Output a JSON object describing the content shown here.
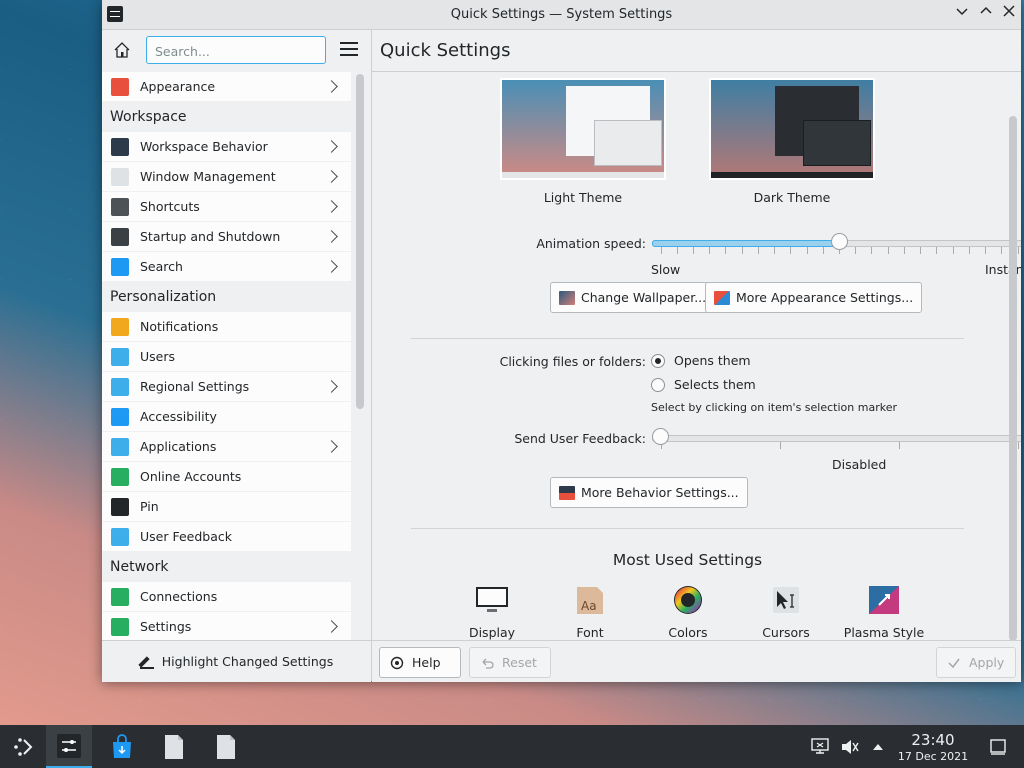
{
  "window": {
    "title": "Quick Settings — System Settings"
  },
  "search": {
    "placeholder": "Search..."
  },
  "sidebar": {
    "items": [
      {
        "label": "Appearance",
        "type": "item",
        "chevron": true,
        "icon": "appearance-icon",
        "color": "#e84f3d"
      },
      {
        "label": "Workspace",
        "type": "section"
      },
      {
        "label": "Workspace Behavior",
        "type": "item",
        "chevron": true,
        "icon": "workspace-behavior-icon",
        "color": "#2d3a4a"
      },
      {
        "label": "Window Management",
        "type": "item",
        "chevron": true,
        "icon": "window-management-icon",
        "color": "#dfe2e5"
      },
      {
        "label": "Shortcuts",
        "type": "item",
        "chevron": true,
        "icon": "keyboard-icon",
        "color": "#4d5257"
      },
      {
        "label": "Startup and Shutdown",
        "type": "item",
        "chevron": true,
        "icon": "monitor-icon",
        "color": "#3b4045"
      },
      {
        "label": "Search",
        "type": "item",
        "chevron": true,
        "icon": "search-icon",
        "color": "#1d99f3"
      },
      {
        "label": "Personalization",
        "type": "section"
      },
      {
        "label": "Notifications",
        "type": "item",
        "chevron": false,
        "icon": "bell-icon",
        "color": "#f2a81d"
      },
      {
        "label": "Users",
        "type": "item",
        "chevron": false,
        "icon": "users-icon",
        "color": "#3daee9"
      },
      {
        "label": "Regional Settings",
        "type": "item",
        "chevron": true,
        "icon": "regional-icon",
        "color": "#3daee9"
      },
      {
        "label": "Accessibility",
        "type": "item",
        "chevron": false,
        "icon": "accessibility-icon",
        "color": "#1d99f3"
      },
      {
        "label": "Applications",
        "type": "item",
        "chevron": true,
        "icon": "applications-icon",
        "color": "#3daee9"
      },
      {
        "label": "Online Accounts",
        "type": "item",
        "chevron": false,
        "icon": "globe-icon",
        "color": "#27ae60"
      },
      {
        "label": "Pin",
        "type": "item",
        "chevron": false,
        "icon": "lock-icon",
        "color": "#232629"
      },
      {
        "label": "User Feedback",
        "type": "item",
        "chevron": false,
        "icon": "feedback-icon",
        "color": "#3daee9"
      },
      {
        "label": "Network",
        "type": "section"
      },
      {
        "label": "Connections",
        "type": "item",
        "chevron": false,
        "icon": "globe-icon",
        "color": "#27ae60"
      },
      {
        "label": "Settings",
        "type": "item",
        "chevron": true,
        "icon": "globe-icon",
        "color": "#27ae60"
      }
    ],
    "highlight_label": "Highlight Changed Settings"
  },
  "main": {
    "title": "Quick Settings",
    "themes": [
      {
        "label": "Light Theme"
      },
      {
        "label": "Dark Theme"
      }
    ],
    "animation": {
      "label": "Animation speed:",
      "min_label": "Slow",
      "max_label": "Instant",
      "value": 0.5
    },
    "buttons": {
      "change_wallpaper": "Change Wallpaper...",
      "more_appearance": "More Appearance Settings...",
      "more_behavior": "More Behavior Settings..."
    },
    "clicking": {
      "label": "Clicking files or folders:",
      "options": [
        "Opens them",
        "Selects them"
      ],
      "selected": "Opens them",
      "hint": "Select by clicking on item's selection marker"
    },
    "feedback": {
      "label": "Send User Feedback:",
      "value_label": "Disabled",
      "value": 0
    },
    "most_used": {
      "title": "Most Used Settings",
      "items": [
        {
          "label": "Display",
          "icon": "display-icon"
        },
        {
          "label": "Font",
          "icon": "font-icon"
        },
        {
          "label": "Colors",
          "icon": "colors-icon"
        },
        {
          "label": "Cursors",
          "icon": "cursors-icon"
        },
        {
          "label": "Plasma Style",
          "icon": "plasma-style-icon"
        }
      ]
    },
    "footer": {
      "help": "Help",
      "reset": "Reset",
      "apply": "Apply"
    }
  },
  "taskbar": {
    "time": "23:40",
    "date": "17 Dec 2021"
  },
  "colors": {
    "accent": "#3daee9",
    "window_bg": "#eff0f1",
    "taskbar_bg": "#2a2e32"
  }
}
